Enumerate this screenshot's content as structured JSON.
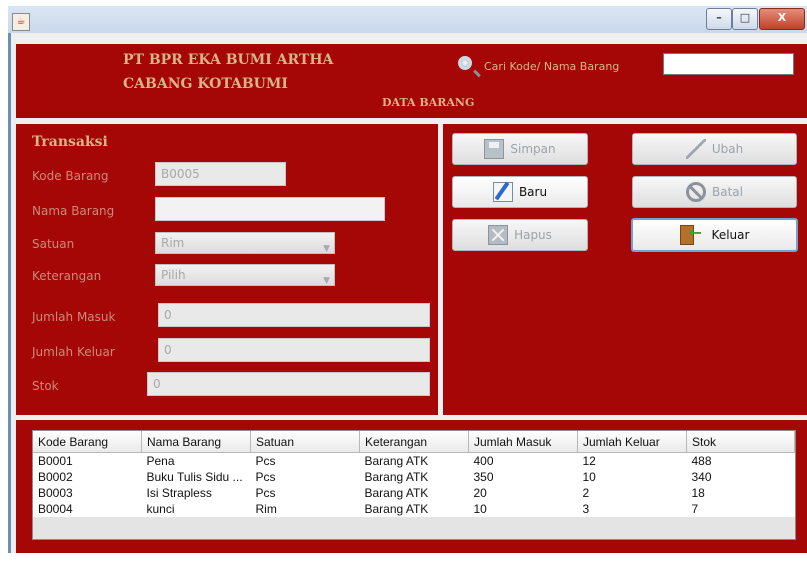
{
  "window": {
    "controls": {
      "minimize": "–",
      "maximize": "□",
      "close": "X"
    }
  },
  "header": {
    "company_line1": "PT BPR EKA BUMI ARTHA",
    "company_line2": "CABANG KOTABUMI",
    "section_title": "DATA BARANG",
    "search": {
      "label": "Cari Kode/ Nama Barang",
      "value": "",
      "icon": "magnifier"
    }
  },
  "form": {
    "title": "Transaksi",
    "fields": {
      "kode_barang": {
        "label": "Kode Barang",
        "value": "B0005"
      },
      "nama_barang": {
        "label": "Nama Barang",
        "value": ""
      },
      "satuan": {
        "label": "Satuan",
        "value": "Rim"
      },
      "keterangan": {
        "label": "Keterangan",
        "value": "Pilih"
      },
      "jumlah_masuk": {
        "label": "Jumlah Masuk",
        "value": "0"
      },
      "jumlah_keluar": {
        "label": "Jumlah Keluar",
        "value": "0"
      },
      "stok": {
        "label": "Stok",
        "value": "0"
      }
    }
  },
  "buttons": {
    "simpan": {
      "label": "Simpan",
      "enabled": false,
      "icon": "save"
    },
    "ubah": {
      "label": "Ubah",
      "enabled": false,
      "icon": "pencil"
    },
    "baru": {
      "label": "Baru",
      "enabled": true,
      "icon": "new-document"
    },
    "batal": {
      "label": "Batal",
      "enabled": false,
      "icon": "cancel"
    },
    "hapus": {
      "label": "Hapus",
      "enabled": false,
      "icon": "delete"
    },
    "keluar": {
      "label": "Keluar",
      "enabled": true,
      "icon": "exit-door"
    }
  },
  "table": {
    "columns": [
      "Kode Barang",
      "Nama Barang",
      "Satuan",
      "Keterangan",
      "Jumlah Masuk",
      "Jumlah Keluar",
      "Stok"
    ],
    "rows": [
      [
        "B0001",
        "Pena",
        "Pcs",
        "Barang ATK",
        "400",
        "12",
        "488"
      ],
      [
        "B0002",
        "Buku Tulis Sidu ...",
        "Pcs",
        "Barang ATK",
        "350",
        "10",
        "340"
      ],
      [
        "B0003",
        "Isi Strapless",
        "Pcs",
        "Barang ATK",
        "20",
        "2",
        "18"
      ],
      [
        "B0004",
        "kunci",
        "Rim",
        "Barang ATK",
        "10",
        "3",
        "7"
      ]
    ]
  },
  "colors": {
    "panel": "#a50707",
    "label": "#d9b48a",
    "client": "#efefef"
  }
}
